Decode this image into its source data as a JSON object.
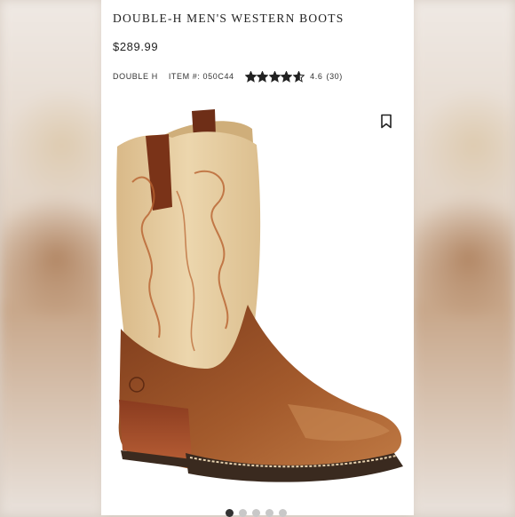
{
  "product": {
    "title": "DOUBLE-H MEN'S WESTERN BOOTS",
    "price": "$289.99",
    "brand": "DOUBLE H",
    "item_label": "ITEM #:",
    "item_number": "050C44",
    "rating_value": "4.6",
    "rating_count": "(30)",
    "stars_filled": 4.6,
    "stars_total": 5
  },
  "icons": {
    "bookmark": "bookmark-icon",
    "star": "star-icon"
  },
  "carousel": {
    "total": 5,
    "active_index": 0
  },
  "colors": {
    "text": "#222222",
    "dot_active": "#333333",
    "dot_inactive": "#c8c8c8",
    "boot_shaft": "#e2c79a",
    "boot_leather": "#9a4f25"
  }
}
